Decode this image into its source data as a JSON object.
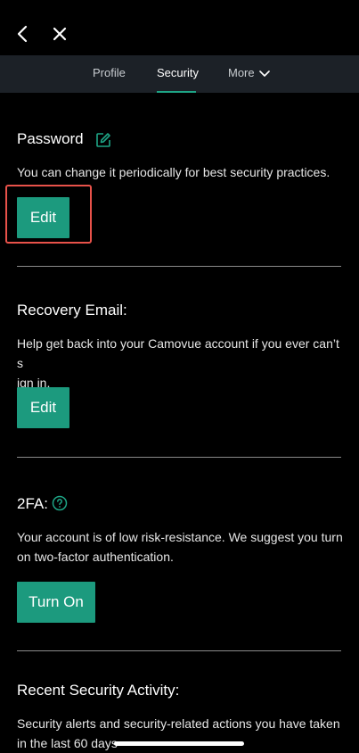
{
  "tabs": [
    {
      "label": "Profile"
    },
    {
      "label": "Security"
    },
    {
      "label": "More"
    }
  ],
  "sections": {
    "password": {
      "title": "Password",
      "description": "You can change it periodically for best security practices.",
      "button": "Edit"
    },
    "recovery": {
      "title": "Recovery Email:",
      "description_line1": "Help get back into your Camovue account if you ever can’t s",
      "description_line2": "ign in.",
      "button": "Edit"
    },
    "twofa": {
      "title": "2FA:",
      "description": "Your account is of low risk-resistance. We suggest you turn on two-factor authentication.",
      "button": "Turn On"
    },
    "activity": {
      "title": "Recent Security Activity:",
      "description": "Security alerts and security-related actions you have taken in the last 60 days"
    }
  },
  "colors": {
    "accent": "#1c9a7e",
    "highlight": "#e8524a",
    "tabbar": "#1c2127"
  },
  "icons": [
    "back-arrow-icon",
    "close-icon",
    "chevron-down-icon",
    "edit-pencil-icon",
    "help-circle-icon"
  ]
}
